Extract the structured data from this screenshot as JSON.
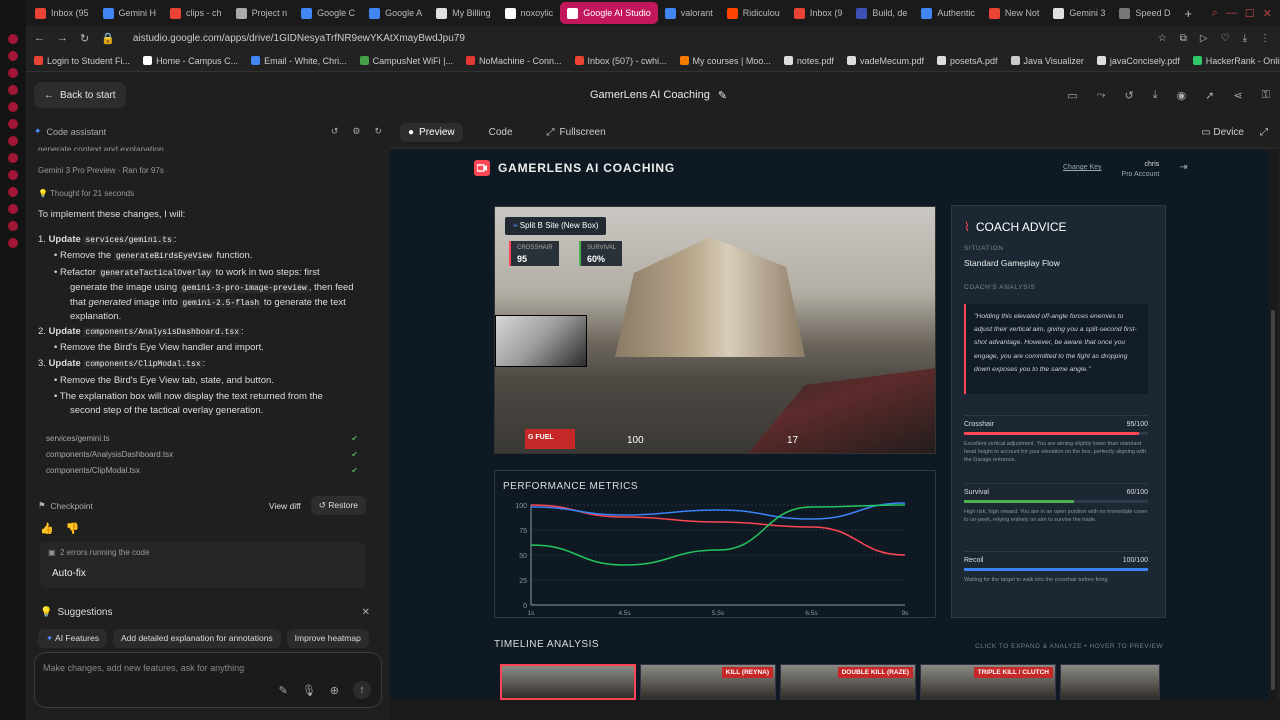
{
  "browser": {
    "tabs": [
      {
        "label": "Inbox (95",
        "color": "#ea4335"
      },
      {
        "label": "Gemini H",
        "color": "#4285f4"
      },
      {
        "label": "clips - ch",
        "color": "#ea4335"
      },
      {
        "label": "Project n",
        "color": "#aaaaaa"
      },
      {
        "label": "Google C",
        "color": "#4285f4"
      },
      {
        "label": "Google A",
        "color": "#4285f4"
      },
      {
        "label": "My Billing",
        "color": "#e0e0e0"
      },
      {
        "label": "noxoylic",
        "color": "#ffffff"
      },
      {
        "label": "Google AI Studio",
        "color": "#ffffff",
        "active": true
      },
      {
        "label": "valorant",
        "color": "#4285f4"
      },
      {
        "label": "Ridiculou",
        "color": "#ff4500"
      },
      {
        "label": "Inbox (9",
        "color": "#ea4335"
      },
      {
        "label": "Build, de",
        "color": "#3f51b5"
      },
      {
        "label": "Authentic",
        "color": "#4285f4"
      },
      {
        "label": "New Not",
        "color": "#ea4335"
      },
      {
        "label": "Gemini 3",
        "color": "#e0e0e0"
      },
      {
        "label": "Speed D",
        "color": "#777777"
      }
    ],
    "url": "aistudio.google.com/apps/drive/1GIDNesyaTrfNR9ewYKAtXmayBwdJpu79",
    "bookmarks": [
      {
        "label": "Login to Student Fi...",
        "color": "#ea4335"
      },
      {
        "label": "Home - Campus C...",
        "color": "#ffffff"
      },
      {
        "label": "Email - White, Chri...",
        "color": "#4285f4"
      },
      {
        "label": "CampusNet WiFi |...",
        "color": "#43a047"
      },
      {
        "label": "NoMachine - Conn...",
        "color": "#e53935"
      },
      {
        "label": "Inbox (507) - cwhi...",
        "color": "#ea4335"
      },
      {
        "label": "My courses | Moo...",
        "color": "#f57c00"
      },
      {
        "label": "notes.pdf",
        "color": "#dddddd"
      },
      {
        "label": "vadeMecum.pdf",
        "color": "#dddddd"
      },
      {
        "label": "posetsA.pdf",
        "color": "#dddddd"
      },
      {
        "label": "Java Visualizer",
        "color": "#cccccc"
      },
      {
        "label": "javaConcisely.pdf",
        "color": "#dddddd"
      },
      {
        "label": "HackerRank - Onlin...",
        "color": "#2ec866"
      }
    ]
  },
  "app": {
    "back_label": "Back to start",
    "title": "GamerLens AI Coaching"
  },
  "assistant": {
    "header": "Code assistant",
    "truncated_line": "generate context and explanation.",
    "model": "Gemini 3 Pro Preview",
    "ran_for": "Ran for 97s",
    "thought": "Thought for 21 seconds",
    "intro": "To implement these changes, I will:",
    "step1_label": "Update",
    "step1_file": "services/gemini.ts",
    "step1a_pre": "Remove the",
    "step1a_code": "generateBirdsEyeView",
    "step1a_post": "function.",
    "step1b_pre": "Refactor",
    "step1b_code": "generateTacticalOverlay",
    "step1b_post": "to work in two steps: first",
    "step1b_l2_pre": "generate the image using",
    "step1b_l2_code": "gemini-3-pro-image-preview",
    "step1b_l2_post": ", then feed",
    "step1b_l3_pre": "that",
    "step1b_l3_em": "generated",
    "step1b_l3_mid": "image into",
    "step1b_l3_code": "gemini-2.5-flash",
    "step1b_l3_post": "to generate the text",
    "step1b_l4": "explanation.",
    "step2_label": "Update",
    "step2_file": "components/AnalysisDashboard.tsx",
    "step2a": "Remove the Bird's Eye View handler and import.",
    "step3_label": "Update",
    "step3_file": "components/ClipModal.tsx",
    "step3a": "Remove the Bird's Eye View tab, state, and button.",
    "step3b_l1": "The explanation box will now display the text returned from the",
    "step3b_l2": "second step of the tactical overlay generation.",
    "files": [
      "services/gemini.ts",
      "components/AnalysisDashboard.tsx",
      "components/ClipModal.tsx"
    ],
    "checkpoint": "Checkpoint",
    "view_diff": "View diff",
    "restore": "Restore",
    "errors": "2 errors running the code",
    "autofix": "Auto-fix",
    "suggestions": "Suggestions",
    "chips": [
      "AI Features",
      "Add detailed explanation for annotations",
      "Improve heatmap"
    ],
    "input_placeholder": "Make changes, add new features, ask for anything"
  },
  "preview_bar": {
    "preview": "Preview",
    "code": "Code",
    "fullscreen": "Fullscreen",
    "device": "Device"
  },
  "gamerlens": {
    "brand": "GAMERLENS AI COACHING",
    "change_key": "Change Key",
    "user": "chris",
    "account": "Pro Account",
    "video": {
      "site": "Split B Site (New Box)",
      "crosshair_label": "CROSSHAIR",
      "crosshair_val": "95",
      "survival_label": "SURVIVAL",
      "survival_val": "60%",
      "hud_left": "G FUEL",
      "hp": "100",
      "ammo": "17"
    },
    "coach": {
      "title": "COACH ADVICE",
      "situation_label": "SITUATION",
      "situation": "Standard Gameplay Flow",
      "analysis_label": "COACH'S ANALYSIS",
      "quote": "\"Holding this elevated off-angle forces enemies to adjust their vertical aim, giving you a split-second first-shot advantage. However, be aware that once you engage, you are committed to the fight as dropping down exposes you to the same angle.\"",
      "metrics": [
        {
          "name": "Crosshair",
          "score": "95/100",
          "value": 0.95,
          "color": "#ff4655",
          "desc": "Excellent vertical adjustment. You are aiming slightly lower than standard head height to account for your elevation on the box, perfectly aligning with the Garage entrance."
        },
        {
          "name": "Survival",
          "score": "60/100",
          "value": 0.6,
          "color": "#4caf50",
          "desc": "High risk, high reward. You are in an open position with no immediate cover to un-peek, relying entirely on aim to survive the trade."
        },
        {
          "name": "Recoil",
          "score": "100/100",
          "value": 1.0,
          "color": "#3b82f6",
          "desc": "Waiting for the target to walk into the crosshair before firing."
        }
      ]
    },
    "perf_title": "PERFORMANCE METRICS",
    "timeline_title": "TIMELINE ANALYSIS",
    "timeline_hint": "CLICK TO EXPAND & ANALYZE • HOVER TO PREVIEW",
    "clips": [
      {
        "tag": ""
      },
      {
        "tag": "KILL (REYNA)"
      },
      {
        "tag": "DOUBLE KILL (RAZE)"
      },
      {
        "tag": "TRIPLE KILL / CLUTCH"
      },
      {
        "tag": ""
      }
    ]
  },
  "chart_data": {
    "type": "line",
    "title": "PERFORMANCE METRICS",
    "x": [
      "1s",
      "4.5s",
      "5.5s",
      "6.5s",
      "9s"
    ],
    "ylim": [
      0,
      100
    ],
    "yticks": [
      0,
      25,
      50,
      75,
      100
    ],
    "series": [
      {
        "color": "#ff4655",
        "values": [
          100,
          88,
          83,
          78,
          50
        ]
      },
      {
        "color": "#3b82f6",
        "values": [
          98,
          90,
          95,
          86,
          102
        ]
      },
      {
        "color": "#22c55e",
        "values": [
          60,
          40,
          55,
          98,
          100
        ]
      }
    ],
    "grid": true
  }
}
